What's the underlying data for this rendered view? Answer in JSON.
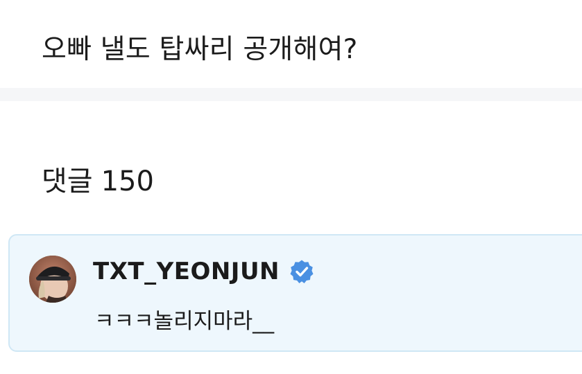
{
  "post": {
    "text": "오빠 낼도 탑싸리 공개해여?"
  },
  "comments": {
    "label": "댓글",
    "count": "150"
  },
  "pinned_comment": {
    "author": "TXT_YEONJUN",
    "verified_icon": "verified-badge-icon",
    "badge_color": "#4a90e2",
    "text": "ㅋㅋㅋ놀리지마라__"
  }
}
